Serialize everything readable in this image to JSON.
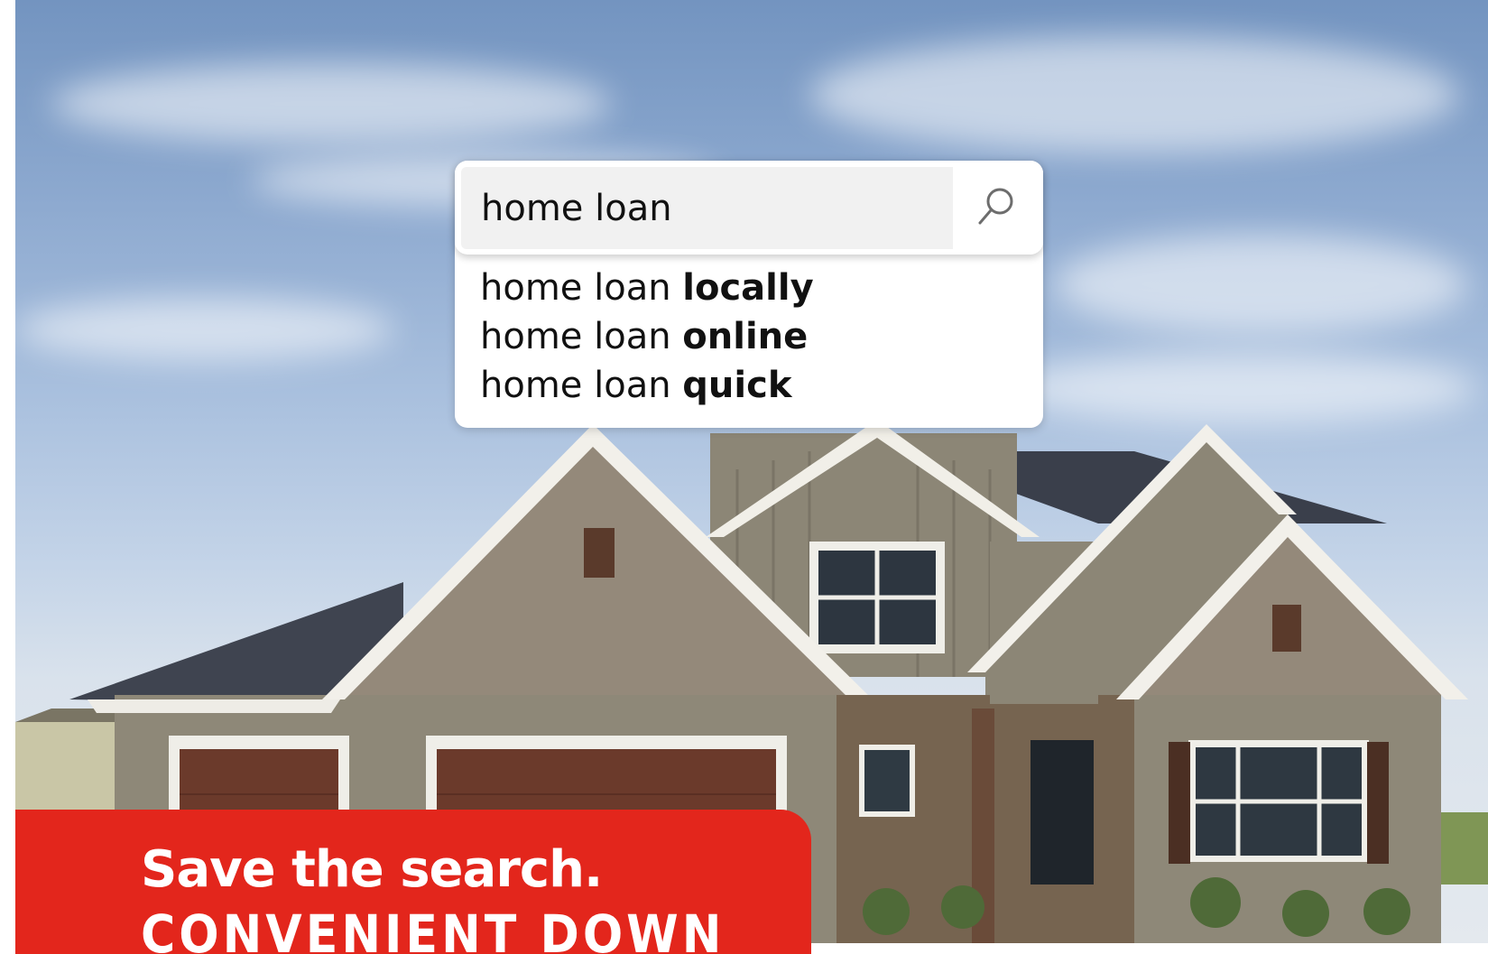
{
  "search": {
    "query": "home loan",
    "suggestions": [
      {
        "prefix": "home loan ",
        "completion": "locally"
      },
      {
        "prefix": "home loan ",
        "completion": "online"
      },
      {
        "prefix": "home loan ",
        "completion": "quick"
      }
    ],
    "button_icon": "search-icon"
  },
  "promo": {
    "headline": "Save the search.",
    "subhead": "CONVENIENT DOWN"
  },
  "colors": {
    "brand_red": "#e3261c",
    "search_bg": "#f1f1f1"
  }
}
